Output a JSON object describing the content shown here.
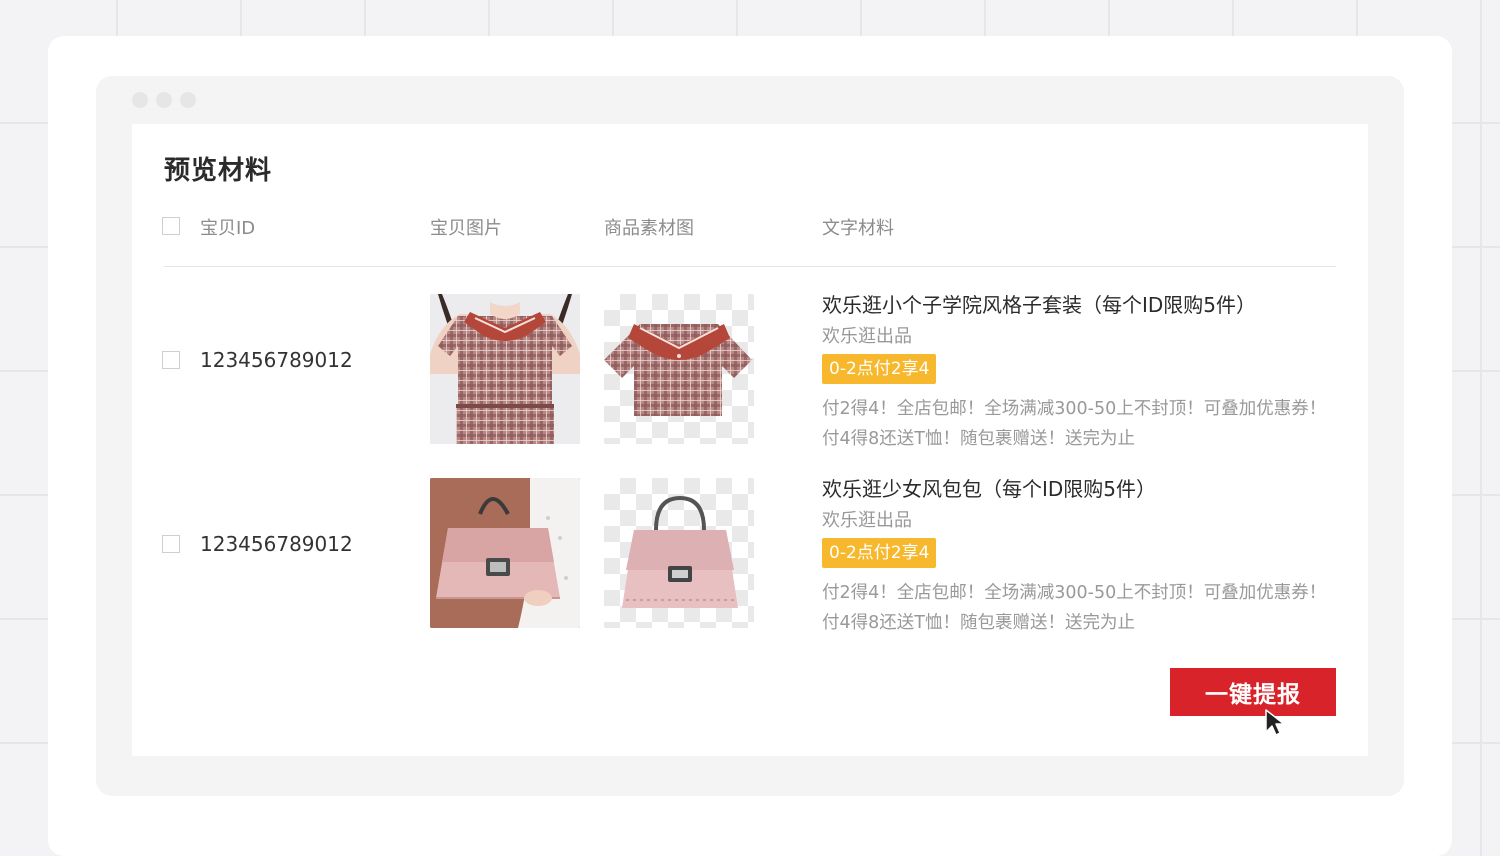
{
  "panel": {
    "title": "预览材料"
  },
  "table": {
    "headers": {
      "id": "宝贝ID",
      "image": "宝贝图片",
      "material": "商品素材图",
      "text": "文字材料"
    },
    "rows": [
      {
        "id": "123456789012",
        "product_image_icon": "plaid-sailor-dress-photo",
        "material_image_icon": "plaid-shirt-cutout",
        "name": "欢乐逛小个子学院风格子套装（每个ID限购5件）",
        "subtitle": "欢乐逛出品",
        "tag": "0-2点付2享4",
        "desc_line1": "付2得4！全店包邮！全场满减300-50上不封顶！可叠加优惠券！",
        "desc_line2": "付4得8还送T恤！随包裹赠送！送完为止"
      },
      {
        "id": "123456789012",
        "product_image_icon": "pink-handbag-photo",
        "material_image_icon": "pink-handbag-cutout",
        "name": "欢乐逛少女风包包（每个ID限购5件）",
        "subtitle": "欢乐逛出品",
        "tag": "0-2点付2享4",
        "desc_line1": "付2得4！全店包邮！全场满减300-50上不封顶！可叠加优惠券！",
        "desc_line2": "付4得8还送T恤！随包裹赠送！送完为止"
      }
    ]
  },
  "actions": {
    "submit_label": "一键提报"
  },
  "colors": {
    "primary": "#d9232a",
    "tag": "#f7b82e",
    "text_primary": "#2b2b2b",
    "text_secondary": "#999999"
  }
}
